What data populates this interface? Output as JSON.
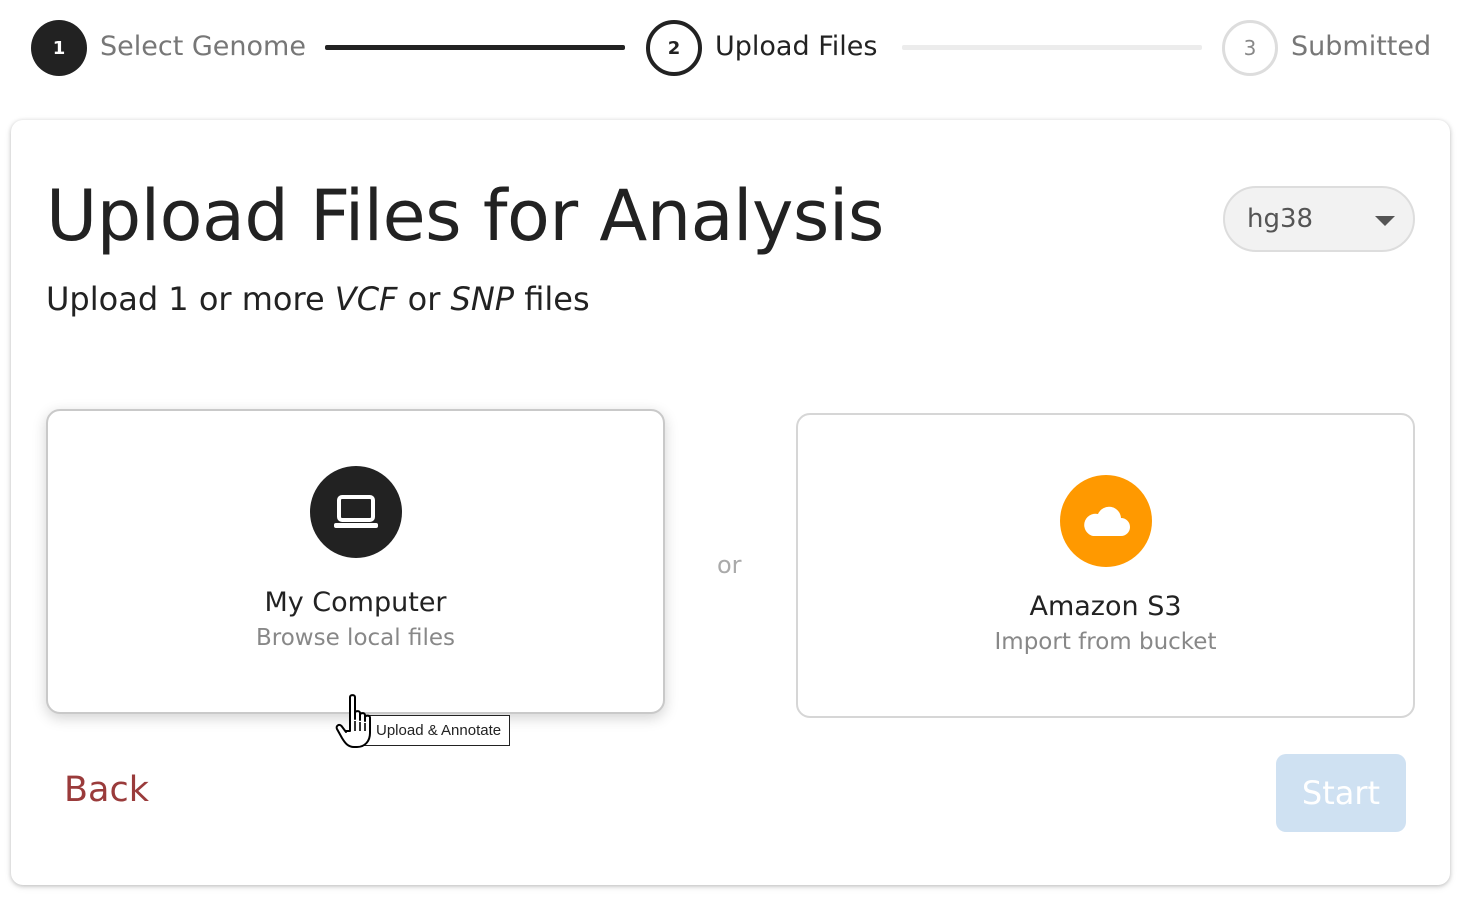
{
  "stepper": {
    "steps": [
      {
        "number": "1",
        "label": "Select Genome",
        "state": "done"
      },
      {
        "number": "2",
        "label": "Upload Files",
        "state": "active"
      },
      {
        "number": "3",
        "label": "Submitted",
        "state": "pending"
      }
    ]
  },
  "main": {
    "title": "Upload Files for Analysis",
    "subtitle_prefix": "Upload 1 or more ",
    "subtitle_fmt1": "VCF",
    "subtitle_mid": " or ",
    "subtitle_fmt2": "SNP",
    "subtitle_suffix": " files",
    "genome_select": {
      "value": "hg38"
    },
    "sources": {
      "local": {
        "title": "My Computer",
        "description": "Browse local files",
        "icon": "laptop-icon"
      },
      "s3": {
        "title": "Amazon S3",
        "description": "Import from bucket",
        "icon": "cloud-icon"
      }
    },
    "or_label": "or",
    "back_label": "Back",
    "start_label": "Start"
  },
  "tooltip": {
    "text": "Upload & Annotate"
  },
  "colors": {
    "primary_dark": "#222222",
    "s3_orange": "#ff9900",
    "back_link": "#9a3b3b",
    "start_disabled": "#cfe1f2"
  }
}
